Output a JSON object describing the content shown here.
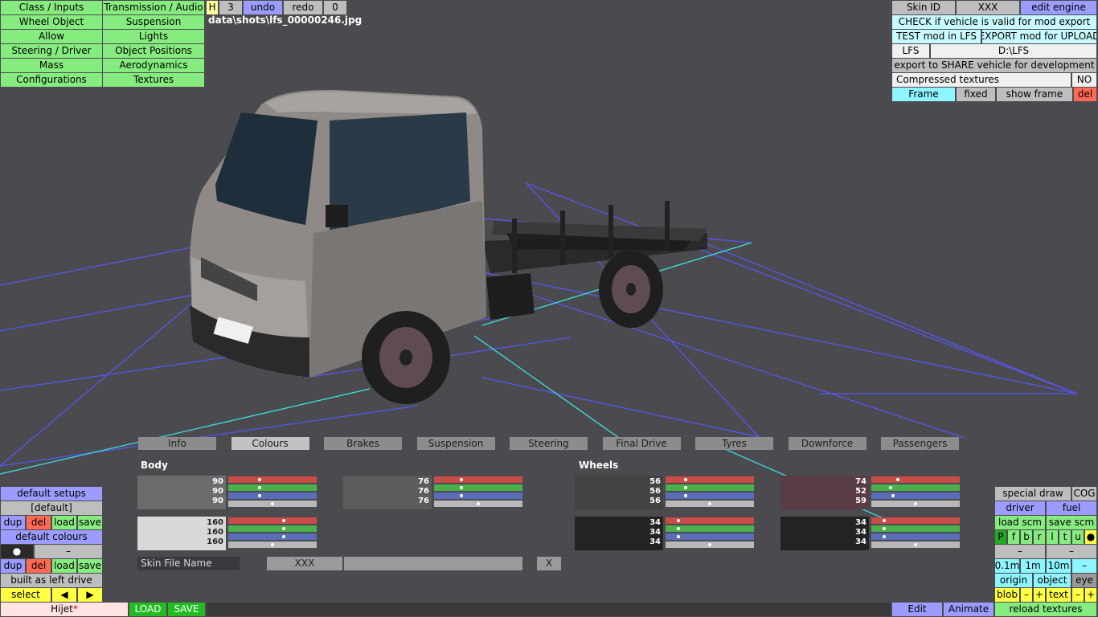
{
  "left_menu": [
    [
      "Class / Inputs",
      "Transmission / Audio"
    ],
    [
      "Wheel Object",
      "Suspension"
    ],
    [
      "Allow",
      "Lights"
    ],
    [
      "Steering / Driver",
      "Object Positions"
    ],
    [
      "Mass",
      "Aerodynamics"
    ],
    [
      "Configurations",
      "Textures"
    ]
  ],
  "top": {
    "h": "H",
    "num": "3",
    "undo": "undo",
    "redo": "redo",
    "zero": "0",
    "file": "data\\shots\\lfs_00000246.jpg"
  },
  "right_top": {
    "skin_id": "Skin ID",
    "skin_val": "XXX",
    "edit_engine": "edit engine",
    "check": "CHECK if vehicle is valid for mod export",
    "test": "TEST mod in LFS",
    "export": "EXPORT mod for UPLOAD",
    "lfs": "LFS",
    "path": "D:\\LFS",
    "share": "export to SHARE vehicle for development",
    "compressed": "Compressed textures",
    "compressed_val": "NO",
    "frame": "Frame",
    "fixed": "fixed",
    "show_frame": "show frame",
    "del": "del"
  },
  "tabs": [
    "Info",
    "Colours",
    "Brakes",
    "Suspension",
    "Steering",
    "Final Drive",
    "Tyres",
    "Downforce",
    "Passengers"
  ],
  "active_tab": "Colours",
  "colours": {
    "body_label": "Body",
    "wheels_label": "Wheels",
    "swatches": [
      {
        "v": [
          "90",
          "90",
          "90"
        ],
        "c": "#6c6c6c"
      },
      {
        "v": [
          "76",
          "76",
          "76"
        ],
        "c": "#5c5c5c"
      },
      {
        "v": [
          "160",
          "160",
          "160"
        ],
        "c": "#d8d8d8"
      },
      {
        "v": [
          "56",
          "56",
          "56"
        ],
        "c": "#434343"
      },
      {
        "v": [
          "74",
          "52",
          "59"
        ],
        "c": "#5a3c44"
      },
      {
        "v": [
          "34",
          "34",
          "34"
        ],
        "c": "#232323"
      },
      {
        "v": [
          "34",
          "34",
          "34"
        ],
        "c": "#232323"
      }
    ],
    "skin_file_label": "Skin File Name",
    "skin_file_val": "XXX",
    "x": "X"
  },
  "left_bottom": {
    "default_setups": "default setups",
    "default": "[default]",
    "dup": "dup",
    "del": "del",
    "load": "load",
    "save": "save",
    "default_colours": "default colours",
    "dot": "●",
    "dash": "–",
    "built": "built as left drive",
    "select": "select",
    "prev": "◀",
    "next": "▶",
    "car_name": "Hijet",
    "star": "*",
    "load_btn": "LOAD",
    "save_btn": "SAVE"
  },
  "right_bottom": {
    "special": "special draw",
    "cog": "COG",
    "driver": "driver",
    "fuel": "fuel",
    "load_scm": "load scm",
    "save_scm": "save scm",
    "letters": [
      "P",
      "f",
      "b",
      "r",
      "l",
      "t",
      "u"
    ],
    "dot": "●",
    "dash": "–",
    "m01": "0.1m",
    "m1": "1m",
    "m10": "10m",
    "minus": "–",
    "origin": "origin",
    "object": "object",
    "eye": "eye",
    "blob": "blob",
    "text": "text",
    "plus": "+",
    "reload": "reload textures"
  },
  "bottom_bar": {
    "edit": "Edit",
    "animate": "Animate"
  }
}
